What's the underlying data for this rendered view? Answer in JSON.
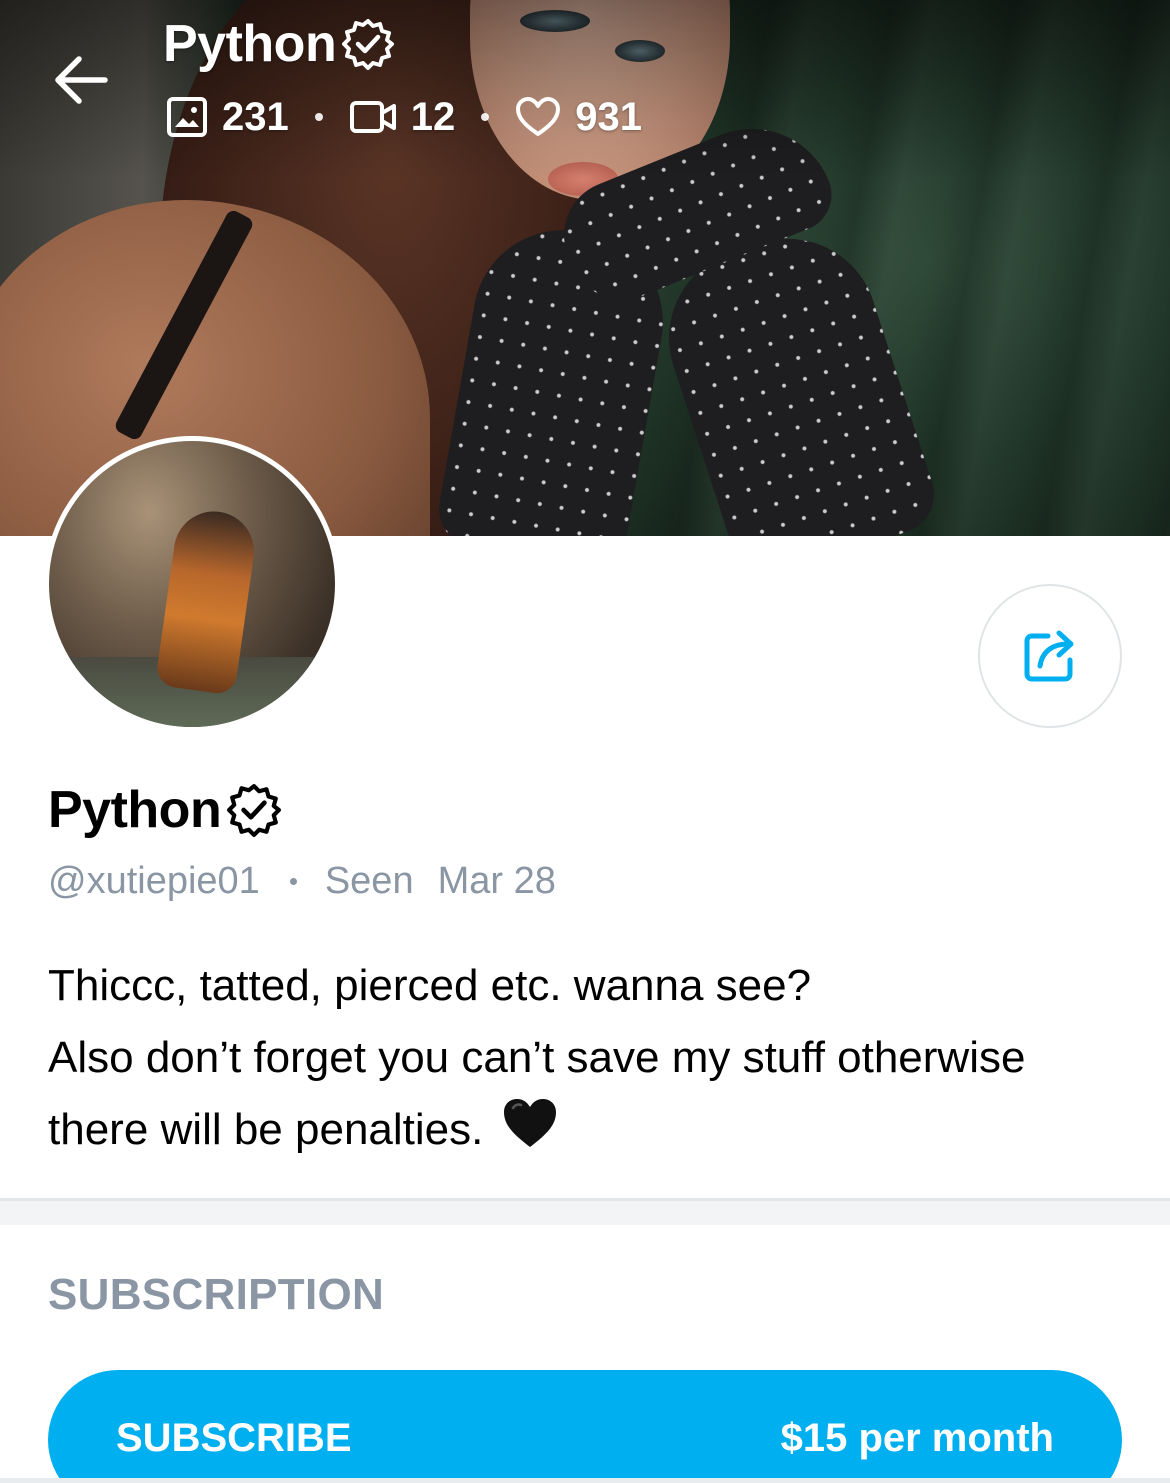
{
  "header": {
    "name": "Python",
    "stats": {
      "photos": "231",
      "videos": "12",
      "likes": "931"
    }
  },
  "profile": {
    "name": "Python",
    "username": "@xutiepie01",
    "seen_label": "Seen",
    "seen_date": "Mar 28",
    "bio": [
      "Thiccc, tatted, pierced etc. wanna see?",
      "Also don’t forget you can’t save my stuff otherwise",
      "there will be penalties."
    ]
  },
  "subscription": {
    "section_title": "SUBSCRIPTION",
    "button_label": "SUBSCRIBE",
    "price": "$15 per month"
  },
  "colors": {
    "accent": "#00aff0",
    "muted_text": "#8a96a3",
    "divider": "#e3e6e8"
  },
  "icons": [
    "back-arrow-icon",
    "verified-badge-icon",
    "image-icon",
    "video-icon",
    "heart-icon",
    "share-icon",
    "black-heart-emoji"
  ]
}
